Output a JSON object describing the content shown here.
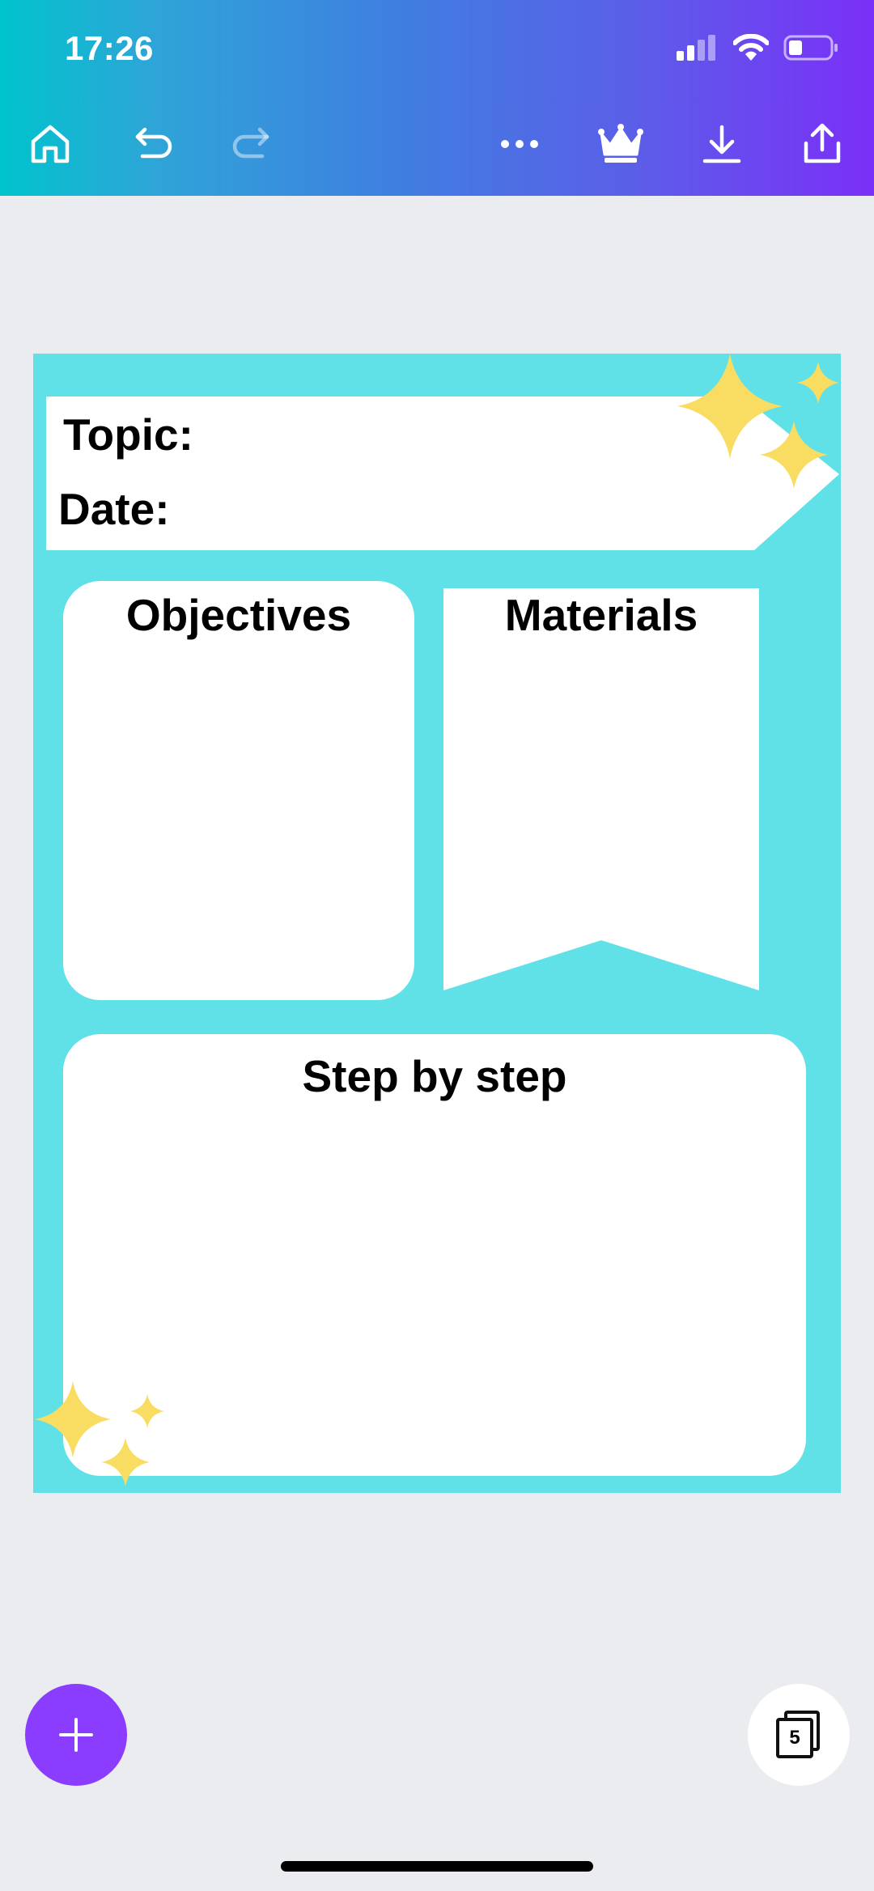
{
  "status_bar": {
    "time": "17:26",
    "icons": [
      "signal-icon",
      "wifi-icon",
      "battery-icon"
    ]
  },
  "toolbar": {
    "items": [
      "home-icon",
      "undo-icon",
      "redo-icon",
      "more-icon",
      "crown-icon",
      "download-icon",
      "share-icon"
    ]
  },
  "design": {
    "topic_label": "Topic:",
    "date_label": "Date:",
    "objectives_title": "Objectives",
    "materials_title": "Materials",
    "steps_title": "Step by step"
  },
  "bottom": {
    "add_icon": "plus-icon",
    "page_count": "5"
  },
  "colors": {
    "toolbar_gradient_start": "#00c4cc",
    "toolbar_gradient_end": "#7b2ff7",
    "page_background": "#5fe1e7",
    "sparkle": "#f8dd62",
    "fab": "#8b3dff",
    "workspace": "#ebecf0"
  }
}
